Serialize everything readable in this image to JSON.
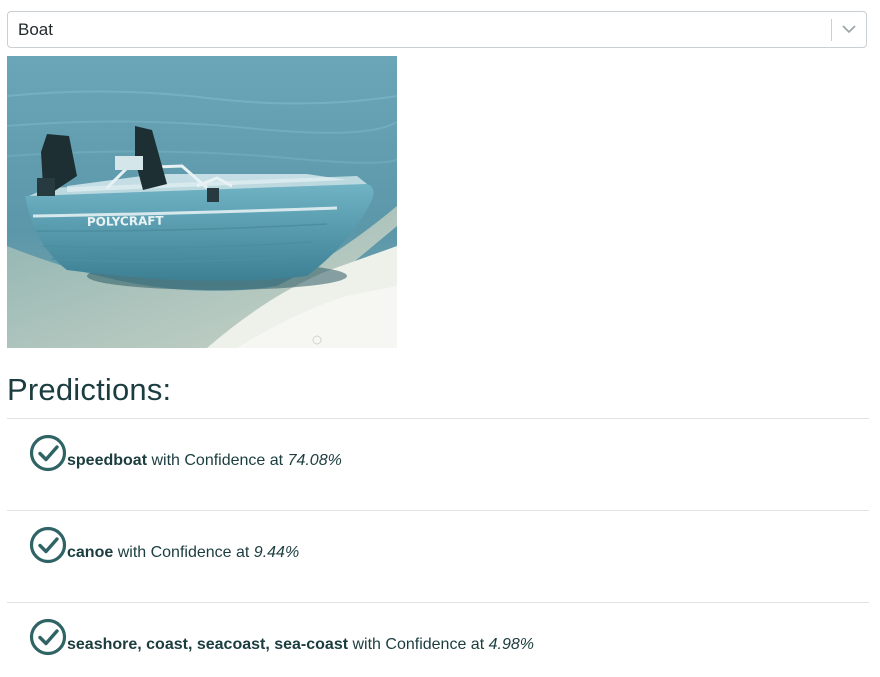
{
  "select": {
    "value": "Boat"
  },
  "image": {
    "hull_text": "POLYCRAFT"
  },
  "predictions": {
    "heading": "Predictions:",
    "items": [
      {
        "label": "speedboat",
        "middle": "with Confidence at",
        "confidence": "74.08%"
      },
      {
        "label": "canoe",
        "middle": "with Confidence at",
        "confidence": "9.44%"
      },
      {
        "label": "seashore, coast, seacoast, sea-coast",
        "middle": "with Confidence at",
        "confidence": "4.98%"
      }
    ]
  },
  "colors": {
    "accent": "#1b3d3f",
    "icon": "#2f6365",
    "rule": "#dfe3e5",
    "water": "#5f9fb1",
    "sand": "#e9ece6"
  }
}
